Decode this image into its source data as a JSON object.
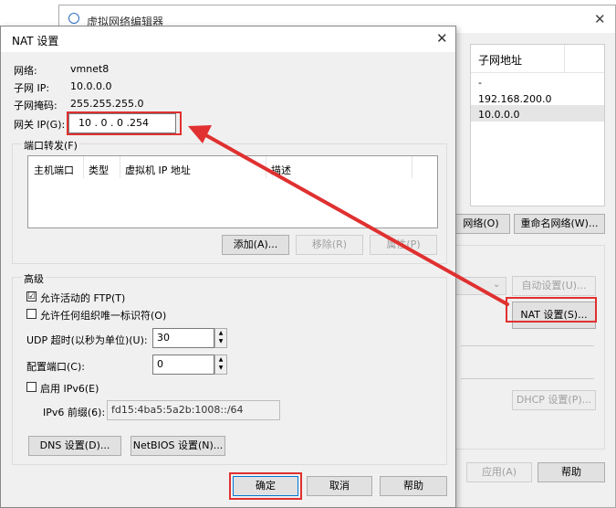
{
  "bg_window": {
    "title": "虚拟网络编辑器",
    "table_header_subnet": "子网地址",
    "rows": [
      "-",
      "192.168.200.0",
      "10.0.0.0"
    ],
    "btn_network": "网络(O)",
    "btn_rename": "重命名网络(W)...",
    "btn_auto": "自动设置(U)...",
    "btn_nat": "NAT 设置(S)...",
    "btn_dhcp": "DHCP 设置(P)...",
    "btn_apply": "应用(A)",
    "btn_help": "帮助"
  },
  "nat": {
    "title": "NAT 设置",
    "network_label": "网络:",
    "network_value": "vmnet8",
    "subnet_ip_label": "子网 IP:",
    "subnet_ip_value": "10.0.0.0",
    "mask_label": "子网掩码:",
    "mask_value": "255.255.255.0",
    "gateway_label": "网关 IP(G):",
    "gateway_value": "10 . 0 . 0 .254",
    "port_forward_label": "端口转发(F)",
    "columns": [
      "主机端口",
      "类型",
      "虚拟机 IP 地址",
      "描述"
    ],
    "btn_add": "添加(A)...",
    "btn_remove": "移除(R)",
    "btn_props": "属性(P)",
    "advanced_label": "高级",
    "cb_ftp": "允许活动的 FTP(T)",
    "cb_ftp_checked": "☑",
    "cb_oui": "允许任何组织唯一标识符(O)",
    "udp_label": "UDP 超时(以秒为单位)(U):",
    "udp_value": "30",
    "config_port_label": "配置端口(C):",
    "config_port_value": "0",
    "cb_ipv6": "启用 IPv6(E)",
    "ipv6_prefix_label": "IPv6 前缀(6):",
    "ipv6_prefix_value": "fd15:4ba5:5a2b:1008::/64",
    "btn_dns": "DNS 设置(D)...",
    "btn_netbios": "NetBIOS 设置(N)...",
    "btn_ok": "确定",
    "btn_cancel": "取消",
    "btn_help": "帮助"
  },
  "colors": {
    "highlight": "#e03030",
    "accent": "#0078d7"
  }
}
